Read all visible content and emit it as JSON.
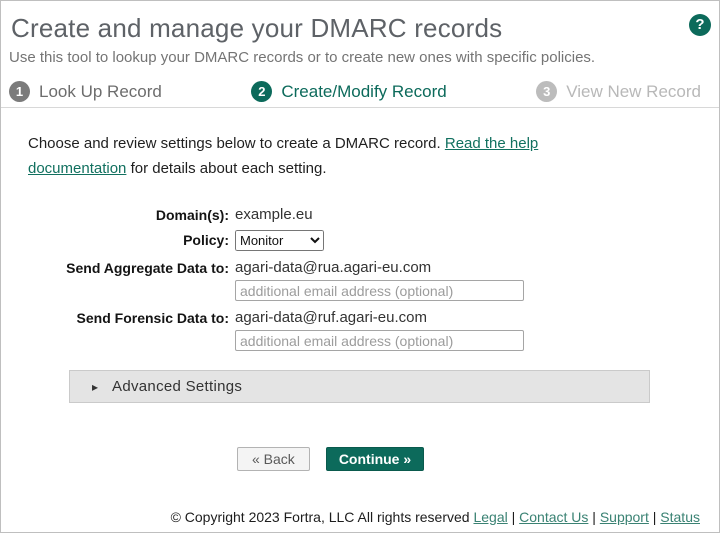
{
  "header": {
    "title": "Create and manage your DMARC records",
    "subtitle": "Use this tool to lookup your DMARC records or to create new ones with specific policies.",
    "help_icon": "?"
  },
  "steps": [
    {
      "number": "1",
      "label": "Look Up Record",
      "state": "done"
    },
    {
      "number": "2",
      "label": "Create/Modify Record",
      "state": "active"
    },
    {
      "number": "3",
      "label": "View New Record",
      "state": "upcoming"
    }
  ],
  "intro": {
    "text_before_link": "Choose and review settings below to create a DMARC record. ",
    "link_text": "Read the help documentation",
    "text_after_link": " for details about each setting."
  },
  "form": {
    "domain_label": "Domain(s):",
    "domain_value": "example.eu",
    "policy_label": "Policy:",
    "policy_value": "Monitor",
    "aggregate_label": "Send Aggregate Data to:",
    "aggregate_value": "agari-data@rua.agari-eu.com",
    "aggregate_placeholder": "additional email address (optional)",
    "forensic_label": "Send Forensic Data to:",
    "forensic_value": "agari-data@ruf.agari-eu.com",
    "forensic_placeholder": "additional email address (optional)"
  },
  "advanced": {
    "expander_icon": "▸",
    "label": "Advanced Settings"
  },
  "buttons": {
    "back": "« Back",
    "continue": "Continue »"
  },
  "footer": {
    "copyright": "© Copyright 2023 Fortra, LLC All rights reserved",
    "separator": "|",
    "links": [
      "Legal",
      "Contact Us",
      "Support",
      "Status"
    ]
  },
  "colors": {
    "accent": "#0c6a5b",
    "link": "#11705f",
    "footer_link": "#3a8273",
    "step_done": "#7b7b7b",
    "step_upcoming": "#bcbcbc"
  }
}
